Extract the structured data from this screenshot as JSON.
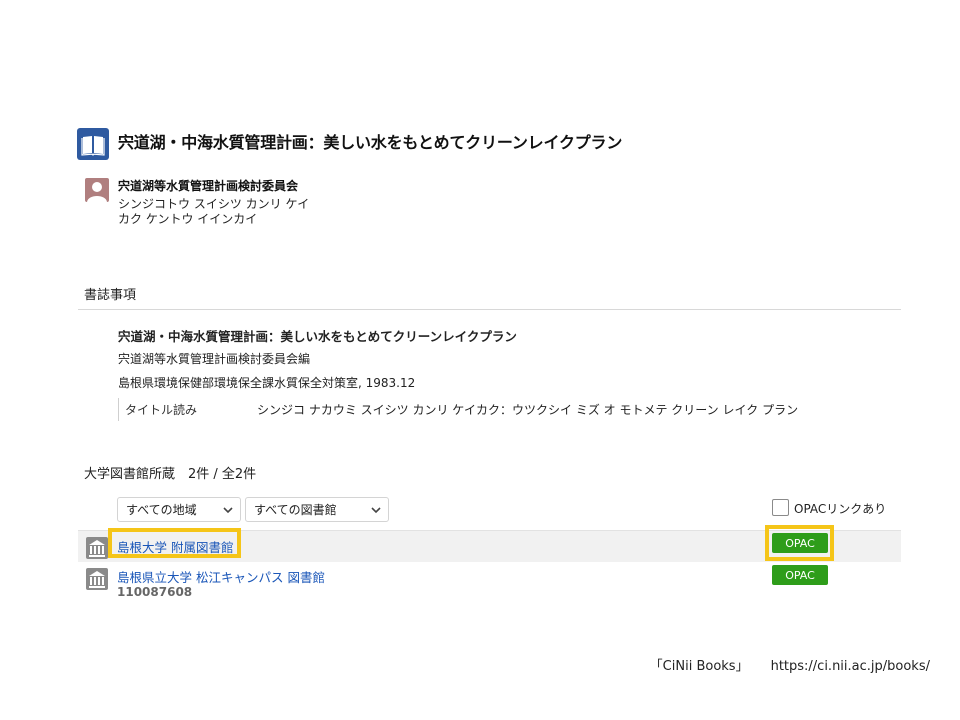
{
  "record": {
    "title": "宍道湖・中海水質管理計画：美しい水をもとめてクリーンレイクプラン",
    "author": {
      "name": "宍道湖等水質管理計画検討委員会",
      "kana": "シンジコトウ スイシツ カンリ ケイカク ケントウ イインカイ"
    }
  },
  "bibliography": {
    "section_title": "書誌事項",
    "title": "宍道湖・中海水質管理計画：美しい水をもとめてクリーンレイクプラン",
    "responsibility": "宍道湖等水質管理計画検討委員会編",
    "publisher": "島根県環境保健部環境保全課水質保全対策室, 1983.12",
    "reading_label": "タイトル読み",
    "reading_value": "シンジコ ナカウミ スイシツ カンリ ケイカク：ウツクシイ ミズ オ モトメテ クリーン レイク プラン"
  },
  "holdings": {
    "header": "大学図書館所蔵　2件 / 全2件",
    "filters": {
      "region": "すべての地域",
      "library": "すべての図書館",
      "opac_checkbox_label": "OPACリンクあり",
      "opac_checkbox_checked": false
    },
    "libraries": [
      {
        "name": "島根大学 附属図書館",
        "id": "",
        "opac_label": "OPAC",
        "highlighted": true
      },
      {
        "name": "島根県立大学 松江キャンパス 図書館",
        "id": "110087608",
        "opac_label": "OPAC",
        "highlighted": false
      }
    ]
  },
  "footer": {
    "source": "「CiNii Books」",
    "url": "https://ci.nii.ac.jp/books/"
  },
  "colors": {
    "book_icon": "#2f5aa0",
    "person_icon": "#b07f7f",
    "link": "#1a56b8",
    "opac_button": "#2e9d1a",
    "highlight": "#f5c518"
  },
  "icons": [
    "book-icon",
    "person-icon",
    "library-icon",
    "chevron-down-icon"
  ]
}
